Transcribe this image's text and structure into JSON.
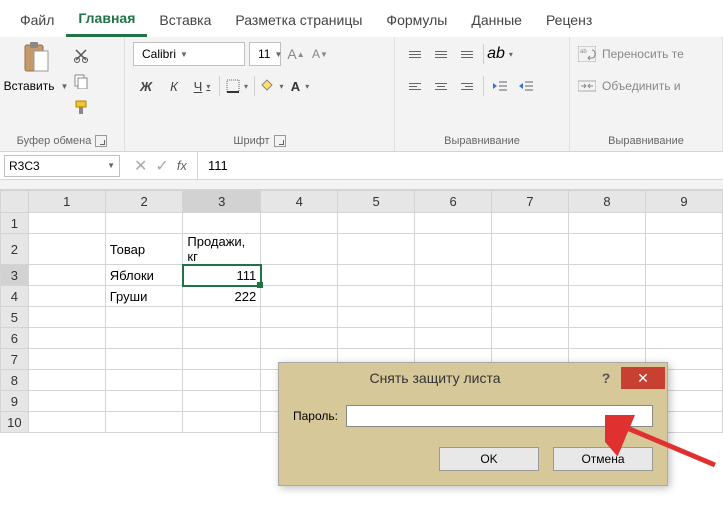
{
  "tabs": {
    "file": "Файл",
    "home": "Главная",
    "insert": "Вставка",
    "layout": "Разметка страницы",
    "formulas": "Формулы",
    "data": "Данные",
    "review": "Реценз"
  },
  "ribbon": {
    "clipboard": {
      "paste": "Вставить",
      "group": "Буфер обмена"
    },
    "font": {
      "name": "Calibri",
      "size": "11",
      "bold": "Ж",
      "italic": "К",
      "underline": "Ч",
      "group": "Шрифт"
    },
    "alignment": {
      "group": "Выравнивание"
    },
    "wrap": {
      "wrap_text": "Переносить те",
      "merge": "Объединить и"
    }
  },
  "formula_bar": {
    "name_box": "R3C3",
    "fx": "fx",
    "value": "111"
  },
  "columns": [
    "1",
    "2",
    "3",
    "4",
    "5",
    "6",
    "7",
    "8",
    "9"
  ],
  "rows": [
    "1",
    "2",
    "3",
    "4",
    "5",
    "6",
    "7",
    "8",
    "9",
    "10"
  ],
  "cells": {
    "r2c2": "Товар",
    "r2c3": "Продажи, кг",
    "r3c2": "Яблоки",
    "r3c3": "111",
    "r4c2": "Груши",
    "r4c3": "222"
  },
  "dialog": {
    "title": "Снять защиту листа",
    "password_label": "Пароль:",
    "ok": "OK",
    "cancel": "Отмена"
  },
  "chart_data": {
    "type": "table",
    "headers": [
      "Товар",
      "Продажи, кг"
    ],
    "rows": [
      [
        "Яблоки",
        111
      ],
      [
        "Груши",
        222
      ]
    ]
  }
}
